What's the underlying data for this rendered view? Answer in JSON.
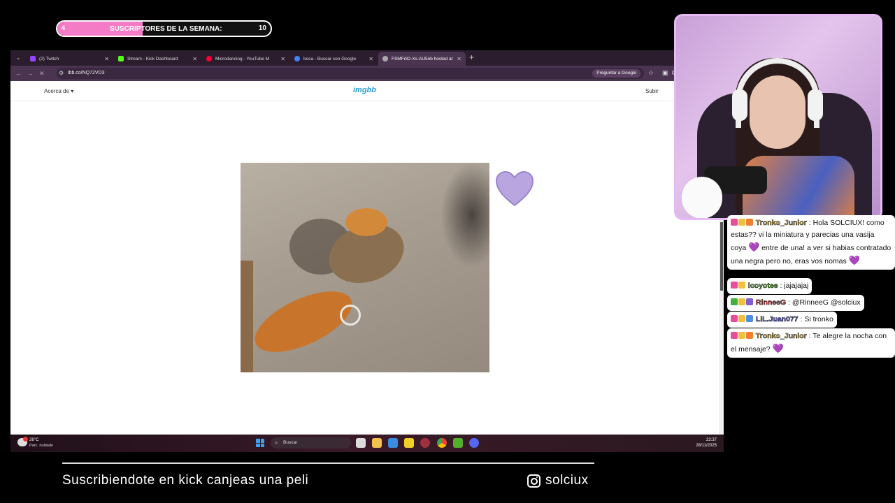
{
  "subs_bar": {
    "count": "4",
    "label": "SUSCRIPTORES DE LA SEMANA:",
    "goal": "10",
    "progress_fraction": 0.4,
    "fill_color": "#f47cc7"
  },
  "browser": {
    "tabs": [
      {
        "title": "(2) Twitch",
        "icon": "twitch-icon",
        "color": "#9146ff"
      },
      {
        "title": "Stream - Kick Dashboard",
        "icon": "kick-icon",
        "color": "#53fc18"
      },
      {
        "title": "Microdancing - YouTube M",
        "icon": "youtube-music-icon",
        "color": "#ff0033"
      },
      {
        "title": "boca - Buscar con Google",
        "icon": "google-icon",
        "color": "#4285f4"
      },
      {
        "title": "FSMFr82-Xs-AU5nb hosted at I",
        "icon": "globe-icon",
        "color": "#aaaaaa"
      }
    ],
    "url": "ibb.co/NQ72VD3",
    "ask_google": "Preguntar a Google"
  },
  "site": {
    "about": "Acerca de ▾",
    "logo": "imgbb",
    "upload": "Subir",
    "logo_color": "#2a9fd6"
  },
  "taskbar": {
    "temp": "26°C",
    "weather": "Parc. nublado",
    "search": "Buscar",
    "time": "22:37",
    "date": "28/11/2025"
  },
  "chat": {
    "messages": [
      {
        "user": "Tronko_Junior",
        "user_color": "#f0d060",
        "text": "Hola SOLCIUX! como estas?? vi la miniatura y parecias una vasija coya 💜 entre de una! a ver si habias contratado una negra pero no, eras vos nomas 💜"
      },
      {
        "user": "lcoyotee",
        "user_color": "#7fe04a",
        "text": "jajajajaj"
      },
      {
        "user": "RinneeG",
        "user_color": "#f05050",
        "text": "@RinneeG @solciux"
      },
      {
        "user": "LiL.Juan077",
        "user_color": "#8080ff",
        "text": "Si tronko"
      },
      {
        "user": "Tronko_Junior",
        "user_color": "#f0d060",
        "text": "Te alegre la nocha con el mensaje? 💜"
      }
    ],
    "msg1_part1": "Hola SOLCIUX! como estas?? vi la miniatura y parecias una vasija coya",
    "msg1_part2": "entre de una! a ver si habias contratado una negra pero no, eras vos nomas",
    "msg5_part1": "Te alegre la nocha con el mensaje?"
  },
  "banner": {
    "text": "Suscribiendote en kick canjeas una peli",
    "instagram": "solciux"
  }
}
